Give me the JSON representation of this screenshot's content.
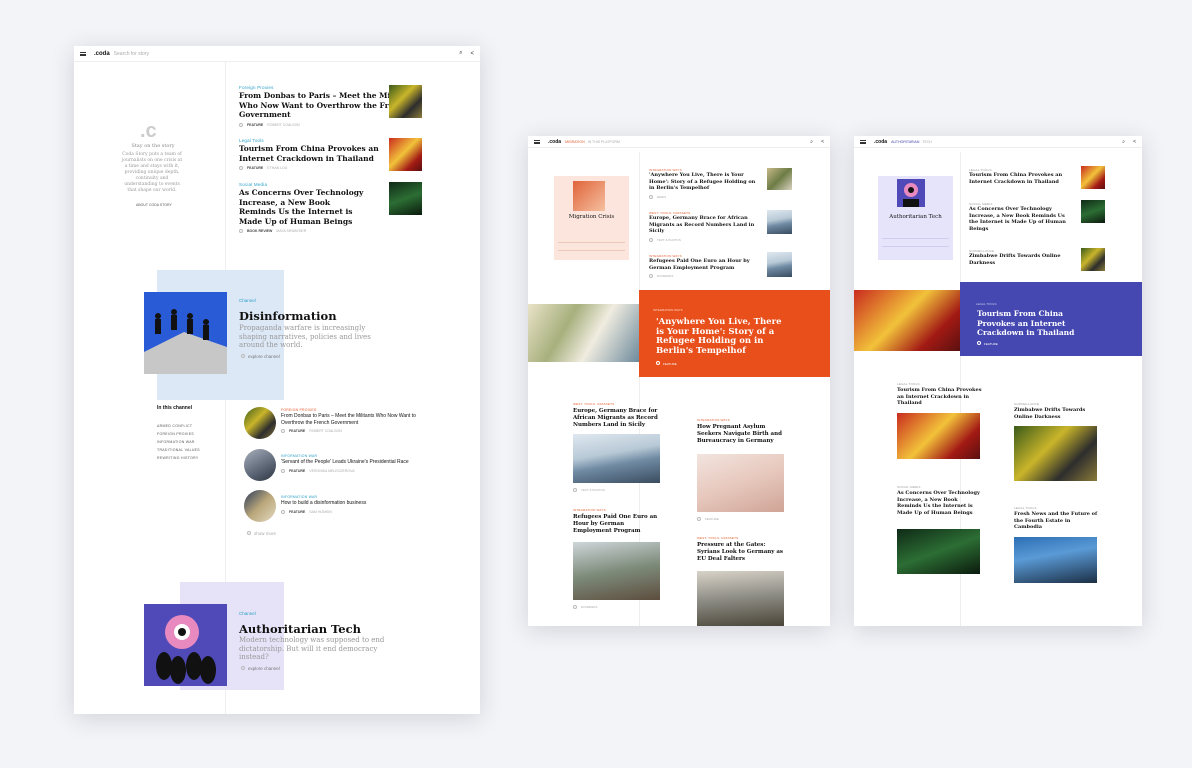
{
  "frame1": {
    "topbar": {
      "logo": ".coda",
      "search_placeholder": "Search for story"
    },
    "intro": {
      "mark": ".c",
      "title": "Stay on the story",
      "text": "Coda Story puts a team of journalists on one crisis at a time and stays with it, providing unique depth, continuity and understanding to events that shape our world.",
      "link": "ABOUT CODA STORY"
    },
    "stories": [
      {
        "category": "Foreign Proxies",
        "title": "From Donbas to Paris – Meet the Militants Who Now Want to Overthrow the French Government",
        "type": "FEATURE",
        "author": "ROBERT COALSON"
      },
      {
        "category": "Legal Tools",
        "title": "Tourism From China Provokes an Internet Crackdown in Thailand",
        "type": "FEATURE",
        "author": "ETHAN LOU"
      },
      {
        "category": "Social Media",
        "title": "As Concerns Over Technology Increase, a New Book Reminds Us the Internet is Made Up of Human Beings",
        "type": "BOOK REVIEW",
        "author": "MAYA SHWAYDER"
      }
    ],
    "disinfo": {
      "label": "Channel",
      "title": "Disinformation",
      "desc": "Propaganda warfare is increasingly shaping narratives, policies and lives around the world.",
      "link": "explore channel"
    },
    "in_channel": {
      "title": "In this channel",
      "items": [
        "ARMED CONFLICT",
        "FOREIGN PROXIES",
        "INFORMATION WAR",
        "TRADITIONAL VALUES",
        "REWRITING HISTORY"
      ]
    },
    "channel_stories": [
      {
        "category": "FOREIGN PROXIES",
        "title": "From Donbas to Paris – Meet the Militants Who Now Want to Overthrow the French Government",
        "type": "FEATURE",
        "author": "ROBERT COALSON"
      },
      {
        "category": "INFORMATION WAR",
        "title": "'Servant of the People' Leads Ukraine's Presidential Race",
        "type": "FEATURE",
        "author": "VERONIKA MELKOZEROVA"
      },
      {
        "category": "INFORMATION WAR",
        "title": "How to build a disinformation business",
        "type": "FEATURE",
        "author": "SAM HOMSIN"
      }
    ],
    "show_more": "show more",
    "auth": {
      "label": "Channel",
      "title": "Authoritarian Tech",
      "desc": "Modern technology was supposed to end dictatorship. But will it end democracy instead?",
      "link": "explore channel"
    }
  },
  "frame2": {
    "topbar": {
      "logo": ".coda",
      "section": "MIGRATION",
      "sub": "IN THIS PLATFORM"
    },
    "channel": {
      "title": "Migration Crisis"
    },
    "side_stories": [
      {
        "category": "INTEGRATION WAYS",
        "title": "'Anywhere You Live, There is Your Home': Story of a Refugee Holding on in Berlin's Tempelhof",
        "author": "DERIS"
      },
      {
        "category": "WEST: TOOLS, DATASETS",
        "title": "Europe, Germany Brace for African Migrants as Record Numbers Land in Sicily",
        "author": "TEXT & PHOTOS"
      },
      {
        "category": "INTEGRATION WAYS",
        "title": "Refugees Paid One Euro an Hour by German Employment Program",
        "author": "DIVIDENDS"
      }
    ],
    "hero": {
      "category": "INTEGRATION WAYS",
      "title": "'Anywhere You Live, There is Your Home': Story of a Refugee Holding on in Berlin's Tempelhof",
      "meta": "FEATURE",
      "accent": "#e84f1b"
    },
    "grid": [
      {
        "category": "WEST: TOOLS, DATASETS",
        "title": "Europe, Germany Brace for African Migrants as Record Numbers Land in Sicily",
        "author": "TEXT & PHOTOS"
      },
      {
        "category": "INTEGRATION WAYS",
        "title": "How Pregnant Asylum Seekers Navigate Birth and Bureaucracy in Germany",
        "author": "FEATURE"
      },
      {
        "category": "INTEGRATION WAYS",
        "title": "Refugees Paid One Euro an Hour by German Employment Program",
        "author": "DIVIDENDS"
      },
      {
        "category": "WEST: TOOLS, DATASETS",
        "title": "Pressure at the Gates: Syrians Look to Germany as EU Deal Falters",
        "author": ""
      }
    ]
  },
  "frame3": {
    "topbar": {
      "logo": ".coda",
      "section": "AUTHORITARIAN",
      "sub": "TECH"
    },
    "channel": {
      "title": "Authoritarian Tech"
    },
    "side_stories": [
      {
        "category": "LEGAL TOOLS",
        "title": "Tourism From China Provokes an Internet Crackdown in Thailand"
      },
      {
        "category": "SOCIAL MEDIA",
        "title": "As Concerns Over Technology Increase, a New Book Reminds Us the Internet is Made Up of Human Beings"
      },
      {
        "category": "SURVEILLANCE",
        "title": "Zimbabwe Drifts Towards Online Darkness"
      }
    ],
    "hero": {
      "category": "LEGAL TOOLS",
      "title": "Tourism From China Provokes an Internet Crackdown in Thailand",
      "meta": "FEATURE",
      "accent": "#4548b0"
    },
    "grid": [
      {
        "category": "LEGAL TOOLS",
        "title": "Tourism From China Provokes an Internet Crackdown in Thailand"
      },
      {
        "category": "SURVEILLANCE",
        "title": "Zimbabwe Drifts Towards Online Darkness"
      },
      {
        "category": "SOCIAL MEDIA",
        "title": "As Concerns Over Technology Increase, a New Book Reminds Us the Internet is Made Up of Human Beings"
      },
      {
        "category": "LEGAL TOOLS",
        "title": "Fresh News and the Future of the Fourth Estate in Cambodia"
      }
    ]
  }
}
